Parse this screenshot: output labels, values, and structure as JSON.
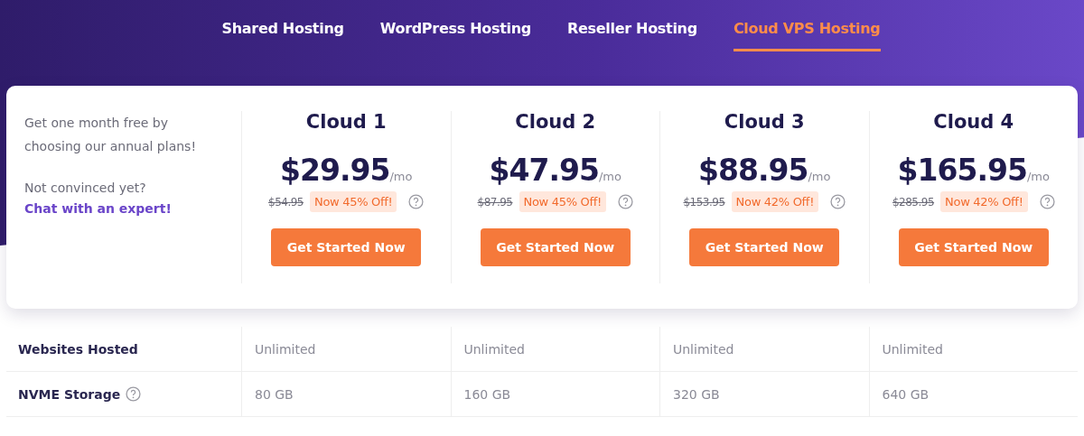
{
  "tabs": [
    {
      "label": "Shared Hosting",
      "selected": false
    },
    {
      "label": "WordPress Hosting",
      "selected": false
    },
    {
      "label": "Reseller Hosting",
      "selected": false
    },
    {
      "label": "Cloud VPS Hosting",
      "selected": true
    }
  ],
  "promo": {
    "text": "Get one month free by choosing our annual plans!",
    "question": "Not convinced yet?",
    "link": "Chat with an expert!"
  },
  "plans": [
    {
      "name": "Cloud 1",
      "price": "$29.95",
      "period": "/mo",
      "old_price": "$54.95",
      "discount": "Now 45% Off!",
      "button": "Get Started Now"
    },
    {
      "name": "Cloud 2",
      "price": "$47.95",
      "period": "/mo",
      "old_price": "$87.95",
      "discount": "Now 45% Off!",
      "button": "Get Started Now"
    },
    {
      "name": "Cloud 3",
      "price": "$88.95",
      "period": "/mo",
      "old_price": "$153.95",
      "discount": "Now 42% Off!",
      "button": "Get Started Now"
    },
    {
      "name": "Cloud 4",
      "price": "$165.95",
      "period": "/mo",
      "old_price": "$285.95",
      "discount": "Now 42% Off!",
      "button": "Get Started Now"
    }
  ],
  "features": [
    {
      "label": "Websites Hosted",
      "help": false,
      "values": [
        "Unlimited",
        "Unlimited",
        "Unlimited",
        "Unlimited"
      ]
    },
    {
      "label": "NVME Storage",
      "help": true,
      "values": [
        "80 GB",
        "160 GB",
        "320 GB",
        "640 GB"
      ]
    }
  ]
}
